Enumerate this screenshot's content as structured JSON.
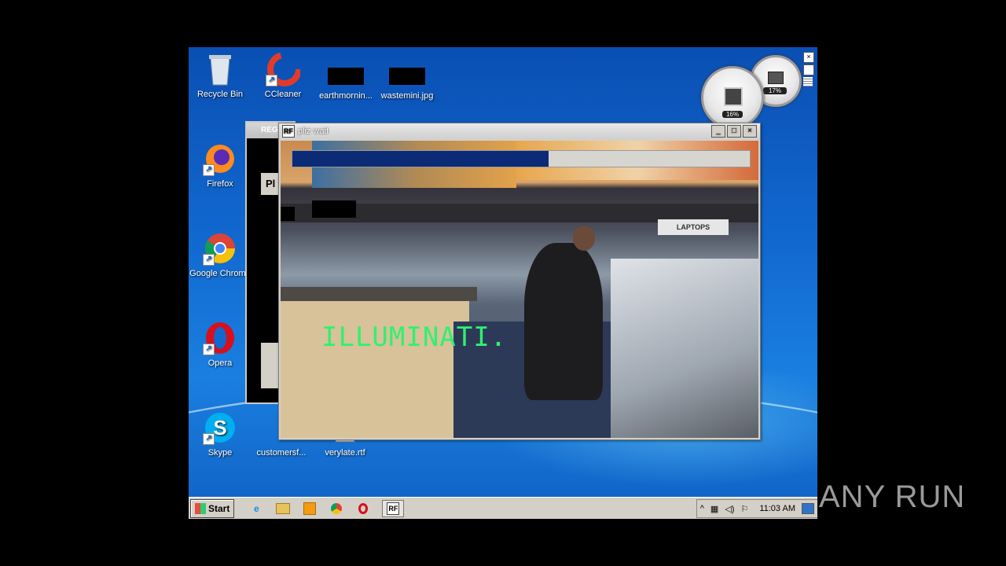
{
  "desktop": {
    "icons": [
      {
        "label": "Recycle Bin",
        "icon": "recycle-bin-icon"
      },
      {
        "label": "CCleaner",
        "icon": "ccleaner-icon"
      },
      {
        "label": "earthmornin...",
        "icon": "image-file-icon"
      },
      {
        "label": "wastemini.jpg",
        "icon": "image-file-icon"
      },
      {
        "label": "Firefox",
        "icon": "firefox-icon"
      },
      {
        "label": "Google Chrome",
        "icon": "chrome-icon"
      },
      {
        "label": "Opera",
        "icon": "opera-icon"
      },
      {
        "label": "Skype",
        "icon": "skype-icon"
      },
      {
        "label": "customersf...",
        "icon": "document-icon"
      },
      {
        "label": "verylate.rtf",
        "icon": "rtf-document-icon"
      }
    ]
  },
  "gadgets": {
    "cpu_label": "16%",
    "memory_label": "17%"
  },
  "background_window": {
    "title": "REG",
    "visible_text": "Pl"
  },
  "main_window": {
    "title": "pliz wait",
    "progress": 0.56,
    "overlay_text": "ILLUMINATI.",
    "scene_sign": "LAPTOPS"
  },
  "taskbar": {
    "start_label": "Start",
    "clock": "11:03 AM"
  },
  "watermark": "ANY RUN",
  "colors": {
    "progress_fill": "#0c2b77",
    "overlay_text": "#31f070",
    "desktop_bg": "#1168cf"
  }
}
